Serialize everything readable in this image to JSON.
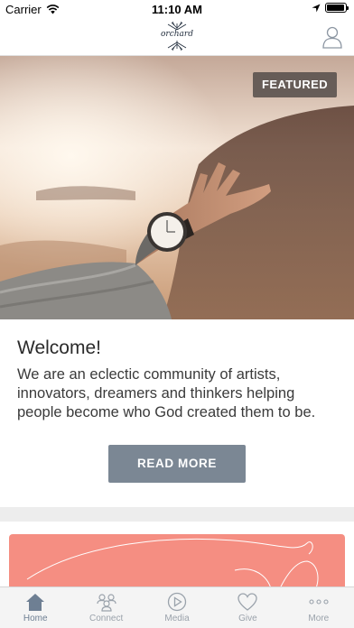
{
  "status_bar": {
    "carrier": "Carrier",
    "time": "11:10 AM",
    "battery_level": 0.95
  },
  "header": {
    "logo_text": "orchard",
    "profile_icon": "person-icon"
  },
  "featured_card": {
    "badge": "FEATURED",
    "title": "Welcome!",
    "body": "We are an eclectic community of artists, innovators, dreamers and thinkers helping people become who God created them to be.",
    "button_label": "READ MORE"
  },
  "tab_bar": {
    "tabs": [
      {
        "label": "Home",
        "icon": "home-icon",
        "active": true
      },
      {
        "label": "Connect",
        "icon": "people-icon",
        "active": false
      },
      {
        "label": "Media",
        "icon": "play-icon",
        "active": false
      },
      {
        "label": "Give",
        "icon": "heart-icon",
        "active": false
      },
      {
        "label": "More",
        "icon": "more-dots-icon",
        "active": false
      }
    ]
  },
  "colors": {
    "accent_button": "#7b8794",
    "secondary_card": "#f58e82",
    "tab_active": "#6e7f93",
    "tab_inactive": "#9aa2ab"
  }
}
